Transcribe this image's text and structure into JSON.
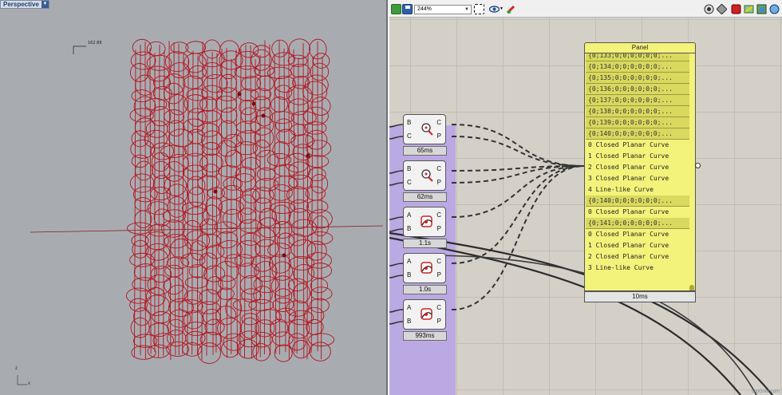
{
  "viewport": {
    "tab_label": "Perspective",
    "dimension_label": "162.88",
    "axis_z": "z",
    "axis_x": "x"
  },
  "toolbar": {
    "zoom": "244%",
    "icons": [
      "new-file-icon",
      "save-icon",
      "zoom-dropdown",
      "fit-view-icon",
      "preview-eye-icon",
      "bake-icon",
      "preview-wire-icon",
      "preview-mesh-icon",
      "preview-shaded-icon",
      "preview-selected-icon",
      "preview-custom-icon"
    ]
  },
  "components": [
    {
      "inputs": [
        "B",
        "C"
      ],
      "outputs": [
        "C",
        "P"
      ],
      "time": "65ms",
      "icon": "curve-closest-point-icon"
    },
    {
      "inputs": [
        "B",
        "C"
      ],
      "outputs": [
        "C",
        "P"
      ],
      "time": "62ms",
      "icon": "curve-closest-point-icon"
    },
    {
      "inputs": [
        "A",
        "B"
      ],
      "outputs": [
        "C",
        "P"
      ],
      "time": "1.1s",
      "icon": "curve-curve-intersect-icon"
    },
    {
      "inputs": [
        "A",
        "B"
      ],
      "outputs": [
        "C",
        "P"
      ],
      "time": "1.0s",
      "icon": "curve-curve-intersect-icon"
    },
    {
      "inputs": [
        "A",
        "B"
      ],
      "outputs": [
        "C",
        "P"
      ],
      "time": "993ms",
      "icon": "curve-curve-intersect-icon"
    }
  ],
  "panel": {
    "title": "Panel",
    "footer": "10ms",
    "rows": [
      {
        "kind": "path",
        "text": "{0;133;0;0;0;0;0;0;..."
      },
      {
        "kind": "path",
        "text": "{0;134;0;0;0;0;0;0;..."
      },
      {
        "kind": "path",
        "text": "{0;135;0;0;0;0;0;0;..."
      },
      {
        "kind": "path",
        "text": "{0;136;0;0;0;0;0;0;..."
      },
      {
        "kind": "path",
        "text": "{0;137;0;0;0;0;0;0;..."
      },
      {
        "kind": "path",
        "text": "{0;138;0;0;0;0;0;0;..."
      },
      {
        "kind": "path",
        "text": "{0;139;0;0;0;0;0;0;..."
      },
      {
        "kind": "path",
        "text": "{0;140;0;0;0;0;0;0;..."
      },
      {
        "kind": "item",
        "text": "0 Closed Planar Curve"
      },
      {
        "kind": "item",
        "text": "1 Closed Planar Curve"
      },
      {
        "kind": "item",
        "text": "2 Closed Planar Curve"
      },
      {
        "kind": "item",
        "text": "3 Closed Planar Curve"
      },
      {
        "kind": "item",
        "text": "4 Line-like Curve"
      },
      {
        "kind": "path",
        "text": "{0;140;0;0;0;0;0;0;..."
      },
      {
        "kind": "item",
        "text": "0 Closed Planar Curve"
      },
      {
        "kind": "path",
        "text": "{0;141;0;0;0;0;0;0;..."
      },
      {
        "kind": "item",
        "text": "0 Closed Planar Curve"
      },
      {
        "kind": "item",
        "text": "1 Closed Planar Curve"
      },
      {
        "kind": "item",
        "text": "2 Closed Planar Curve"
      },
      {
        "kind": "item",
        "text": "3 Line-like Curve"
      }
    ]
  },
  "watermark": "clipGnet.com",
  "colors": {
    "viewport_bg": "#a8acb1",
    "curve_red": "#b4141e",
    "panel_yellow": "#f3f27a",
    "group_purple": "#b9a6e6",
    "canvas_bg": "#d4d0c8"
  }
}
